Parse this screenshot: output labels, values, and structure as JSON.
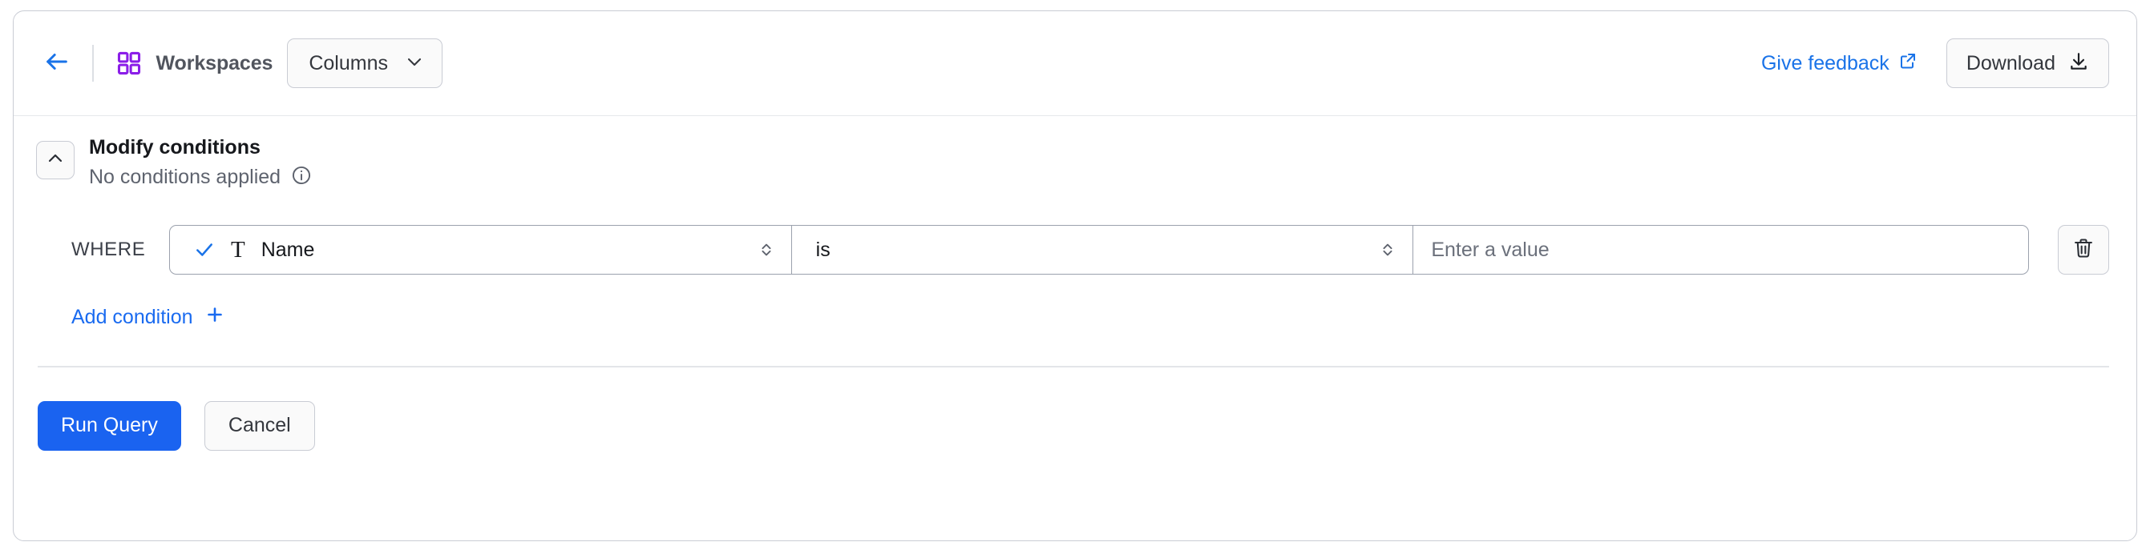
{
  "header": {
    "back_icon": "arrow-left-icon",
    "workspaces_icon": "grid-squares-icon",
    "title": "Workspaces",
    "columns_button": {
      "label": "Columns",
      "icon": "chevron-down-icon"
    },
    "feedback_link": {
      "label": "Give feedback",
      "icon": "external-link-icon"
    },
    "download_button": {
      "label": "Download",
      "icon": "download-icon"
    }
  },
  "conditions_panel": {
    "collapse_icon": "chevron-up-icon",
    "title": "Modify conditions",
    "subtitle": "No conditions applied",
    "info_icon": "info-circle-icon",
    "where_label": "WHERE",
    "condition": {
      "field": {
        "check_icon": "check-icon",
        "type_icon": "text-type-T-icon",
        "value": "Name",
        "stepper_icon": "chevron-up-down-icon"
      },
      "operator": {
        "value": "is",
        "stepper_icon": "chevron-up-down-icon"
      },
      "value_input": {
        "value": "",
        "placeholder": "Enter a value"
      },
      "delete_icon": "trash-icon"
    },
    "add_condition": {
      "label": "Add condition",
      "icon": "plus-icon"
    }
  },
  "footer": {
    "run_query_label": "Run Query",
    "cancel_label": "Cancel"
  },
  "colors": {
    "accent_blue": "#1a63f0",
    "link_blue": "#1a73e8",
    "workspaces_purple": "#8b1ee8",
    "border_grey": "#c9ccd4",
    "field_border": "#9ba1ad",
    "muted_text": "#5e636e"
  }
}
